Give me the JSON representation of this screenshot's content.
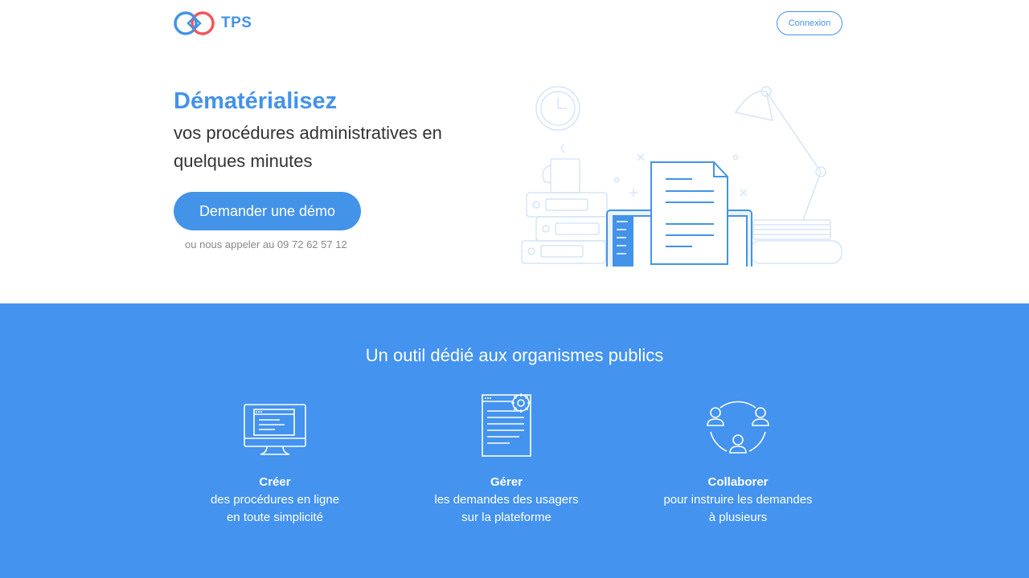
{
  "header": {
    "brand": "TPS",
    "login_label": "Connexion"
  },
  "hero": {
    "title": "Dématérialisez",
    "subtitle": "vos procédures administratives en quelques minutes",
    "demo_button": "Demander une démo",
    "call_text": "ou nous appeler au 09 72 62 57 12"
  },
  "features_section": {
    "title": "Un outil dédié aux organismes publics",
    "items": [
      {
        "title": "Créer",
        "line1": "des procédures en ligne",
        "line2": "en toute simplicité",
        "icon": "monitor-icon"
      },
      {
        "title": "Gérer",
        "line1": "les demandes des usagers",
        "line2": "sur la plateforme",
        "icon": "document-gear-icon"
      },
      {
        "title": "Collaborer",
        "line1": "pour instruire les demandes",
        "line2": "à plusieurs",
        "icon": "people-circle-icon"
      }
    ]
  },
  "colors": {
    "brand_blue": "#4393e8",
    "band_blue": "#4393ef",
    "logo_red": "#f0575a"
  }
}
